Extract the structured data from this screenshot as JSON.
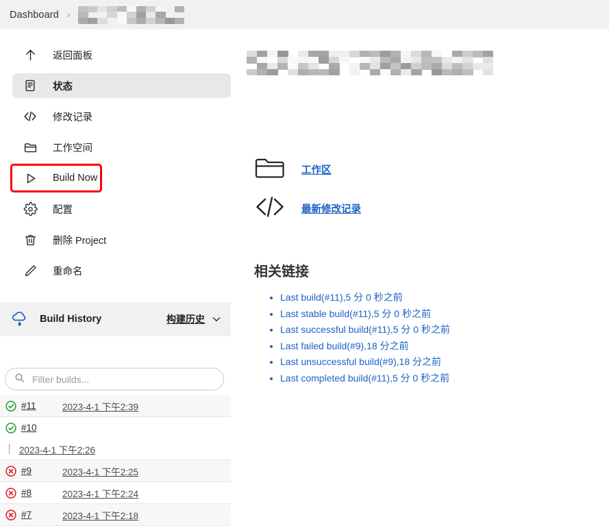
{
  "breadcrumb": {
    "root_label": "Dashboard",
    "separator": "›",
    "redacted_item": ""
  },
  "colors": {
    "accent_link": "#1b61c4",
    "highlight_box": "#fb0007",
    "success": "#2e9e3e",
    "failure": "#d9262c",
    "header_bg": "#f1f1f1",
    "active_item_bg": "#e8e8e8"
  },
  "sidebar": {
    "items": [
      {
        "label": "返回面板",
        "icon": "arrow-up-icon",
        "active": false,
        "highlighted": false
      },
      {
        "label": "状态",
        "icon": "status-document-icon",
        "active": true,
        "highlighted": false
      },
      {
        "label": "修改记录",
        "icon": "code-brackets-icon",
        "active": false,
        "highlighted": false
      },
      {
        "label": "工作空间",
        "icon": "folder-icon",
        "active": false,
        "highlighted": false
      },
      {
        "label": "Build Now",
        "icon": "play-triangle-icon",
        "active": false,
        "highlighted": true
      },
      {
        "label": "配置",
        "icon": "gear-icon",
        "active": false,
        "highlighted": false
      },
      {
        "label": "删除 Project",
        "icon": "trash-icon",
        "active": false,
        "highlighted": false
      },
      {
        "label": "重命名",
        "icon": "pencil-icon",
        "active": false,
        "highlighted": false
      }
    ],
    "build_history": {
      "title": "Build History",
      "icon": "cloud-weather-icon",
      "link_label": "构建历史",
      "chevron": "chevron-down-icon",
      "filter": {
        "placeholder": "Filter builds...",
        "value": "",
        "icon": "search-icon"
      },
      "builds": [
        {
          "number": "#11",
          "timestamp": "2023-4-1 下午2:39",
          "status": "success",
          "wrapped": false
        },
        {
          "number": "#10",
          "timestamp": "2023-4-1 下午2:26",
          "status": "success",
          "wrapped": true
        },
        {
          "number": "#9",
          "timestamp": "2023-4-1 下午2:25",
          "status": "failure",
          "wrapped": false
        },
        {
          "number": "#8",
          "timestamp": "2023-4-1 下午2:24",
          "status": "failure",
          "wrapped": false
        },
        {
          "number": "#7",
          "timestamp": "2023-4-1 下午2:18",
          "status": "failure",
          "wrapped": false
        }
      ]
    }
  },
  "main": {
    "page_title_redacted": "",
    "quick_links": [
      {
        "label": "工作区",
        "icon": "folder-icon"
      },
      {
        "label": "最新修改记录",
        "icon": "code-brackets-icon"
      }
    ],
    "related_links_heading": "相关链接",
    "related_links": [
      "Last build(#11),5 分 0 秒之前",
      "Last stable build(#11),5 分 0 秒之前",
      "Last successful build(#11),5 分 0 秒之前",
      "Last failed build(#9),18 分之前",
      "Last unsuccessful build(#9),18 分之前",
      "Last completed build(#11),5 分 0 秒之前"
    ]
  }
}
